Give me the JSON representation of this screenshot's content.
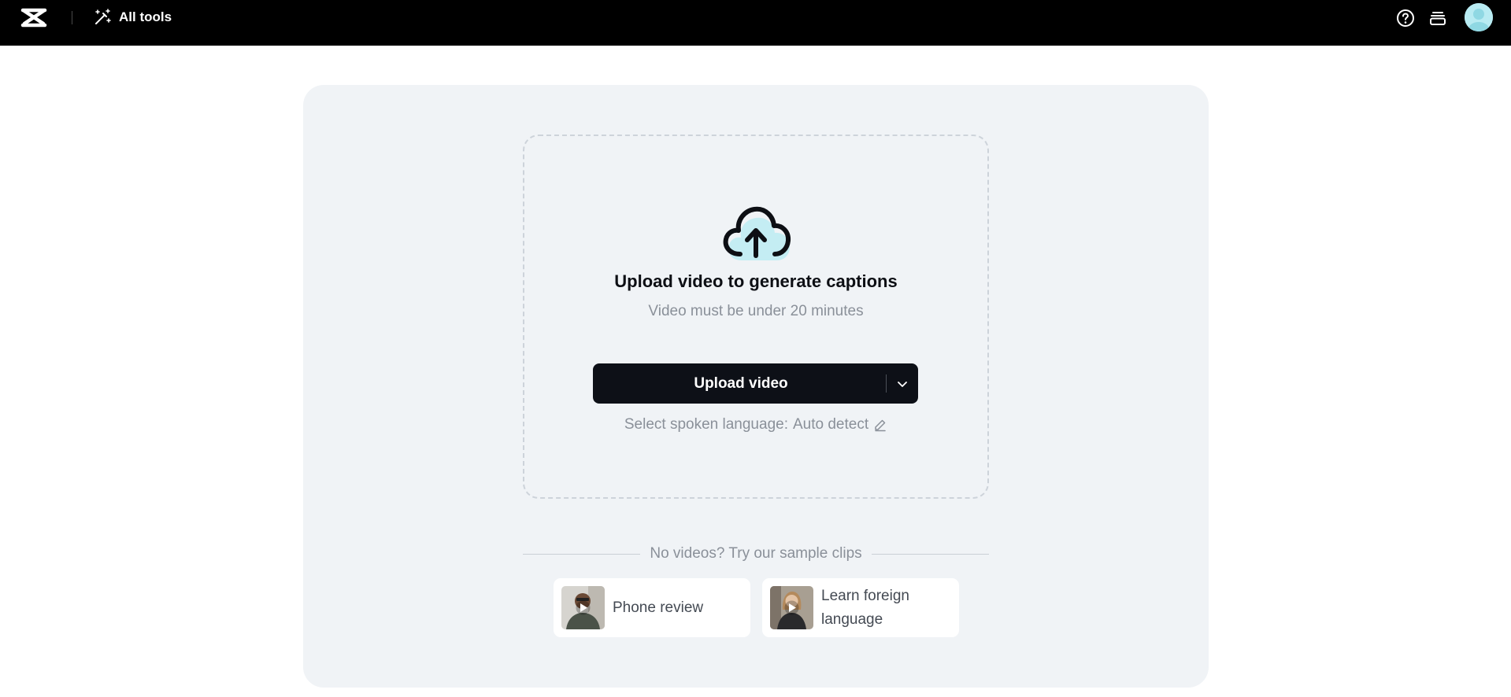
{
  "topbar": {
    "logo_icon": "capcut-logo-icon",
    "all_tools_icon": "magic-wand-icon",
    "all_tools_label": "All tools",
    "help_icon": "help-circle-icon",
    "layers_icon": "layers-icon",
    "avatar_icon": "user-avatar-icon"
  },
  "upload": {
    "icon": "cloud-upload-icon",
    "title": "Upload video to generate captions",
    "subtitle": "Video must be under 20 minutes",
    "button_label": "Upload video",
    "dropdown_icon": "chevron-down-icon",
    "language_prefix": "Select spoken language:",
    "language_value": "Auto detect",
    "edit_icon": "pencil-icon"
  },
  "samples": {
    "heading": "No videos? Try our sample clips",
    "items": [
      {
        "label": "Phone review",
        "icon": "play-icon"
      },
      {
        "label": "Learn foreign language",
        "icon": "play-icon"
      }
    ]
  },
  "colors": {
    "topbar_bg": "#000000",
    "panel_bg": "#f0f3f6",
    "button_bg": "#0d1017",
    "accent_cyan": "#b8ebf2",
    "muted_text": "#8a9099"
  }
}
